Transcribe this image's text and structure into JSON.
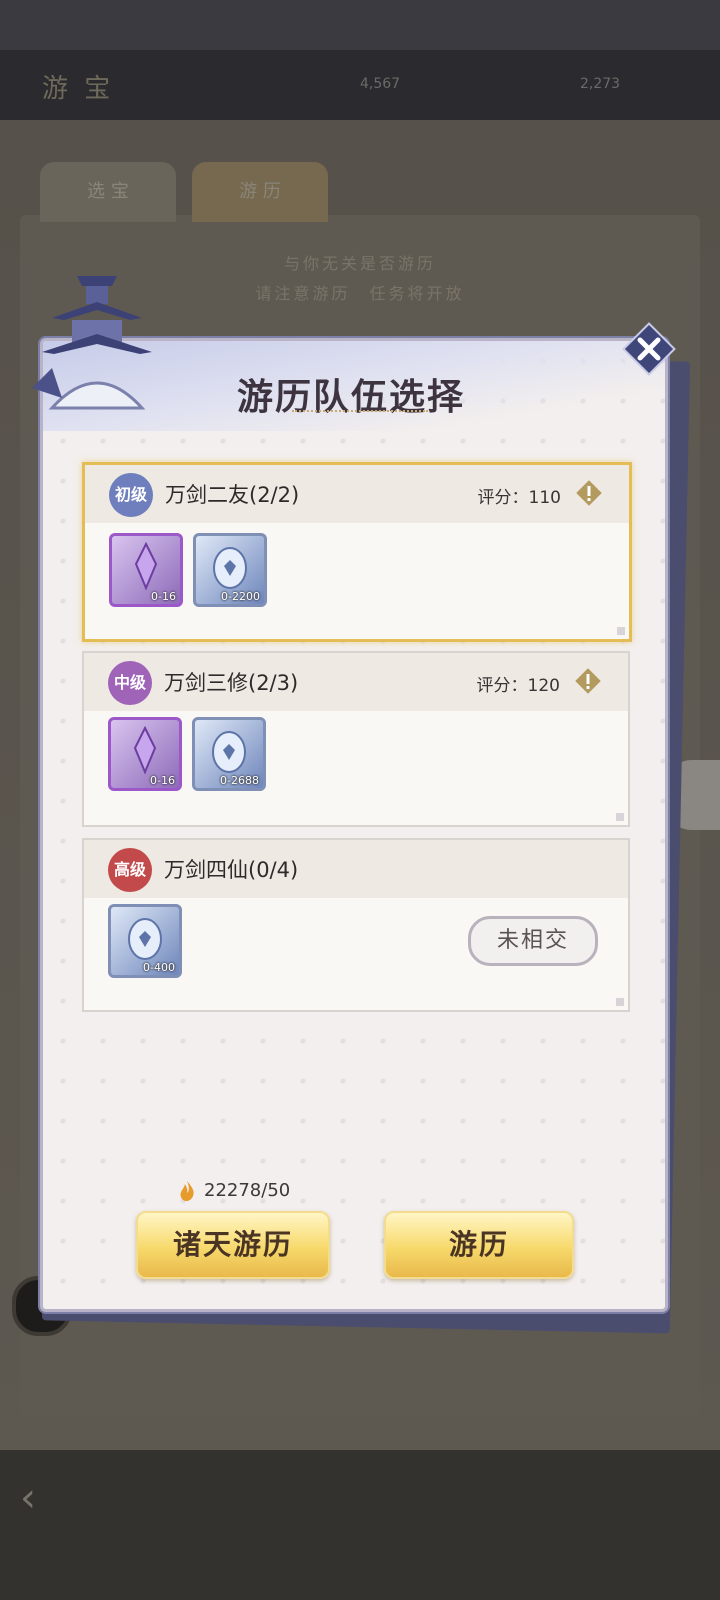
{
  "background": {
    "title": "游 宝",
    "resource_a": "4,567",
    "resource_b": "2,273",
    "tabs": [
      "选 宝",
      "游 历"
    ],
    "hint_lines": [
      "与你无关是否游历",
      "请注意游历　任务将开放"
    ]
  },
  "dialog": {
    "title": "游历队伍选择",
    "score_label": "评分：",
    "teams": [
      {
        "level": "初级",
        "name": "万剑二友(2/2)",
        "score": "110",
        "items": [
          {
            "kind": "purple",
            "qty": "0-16"
          },
          {
            "kind": "blue",
            "qty": "0-2200"
          }
        ]
      },
      {
        "level": "中级",
        "name": "万剑三修(2/3)",
        "score": "120",
        "items": [
          {
            "kind": "purple",
            "qty": "0-16"
          },
          {
            "kind": "blue",
            "qty": "0-2688"
          }
        ]
      },
      {
        "level": "高级",
        "name": "万剑四仙(0/4)",
        "status": "未相交",
        "items": [
          {
            "kind": "blue",
            "qty": "0-400"
          }
        ]
      }
    ],
    "energy": "22278/50",
    "buttons": {
      "all_heavens": "诸天游历",
      "travel": "游历"
    }
  },
  "colors": {
    "gold_border": "#e5bd56",
    "level_primary": "#6f7fbd",
    "level_mid": "#9f64b8",
    "level_high": "#c34a4b"
  },
  "icons": [
    "close-icon",
    "diamond-score-icon",
    "flame-energy-icon",
    "crystal-item-icon",
    "spirit-egg-item-icon"
  ]
}
